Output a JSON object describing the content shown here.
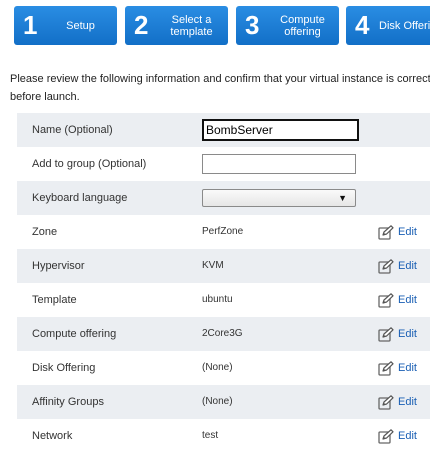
{
  "steps": [
    {
      "number": "1",
      "label": "Setup"
    },
    {
      "number": "2",
      "label": "Select a template"
    },
    {
      "number": "3",
      "label": "Compute offering"
    },
    {
      "number": "4",
      "label": "Disk Offeri"
    }
  ],
  "intro": "Please review the following information and confirm that your virtual instance is correct before launch.",
  "form": {
    "name": {
      "label": "Name (Optional)",
      "value": "BombServer"
    },
    "group": {
      "label": "Add to group (Optional)",
      "value": ""
    },
    "keyboard": {
      "label": "Keyboard language",
      "value": ""
    },
    "rows": [
      {
        "label": "Zone",
        "value": "PerfZone",
        "edit": "Edit"
      },
      {
        "label": "Hypervisor",
        "value": "KVM",
        "edit": "Edit"
      },
      {
        "label": "Template",
        "value": "ubuntu",
        "edit": "Edit"
      },
      {
        "label": "Compute offering",
        "value": "2Core3G",
        "edit": "Edit"
      },
      {
        "label": "Disk Offering",
        "value": "(None)",
        "edit": "Edit"
      },
      {
        "label": "Affinity Groups",
        "value": "(None)",
        "edit": "Edit"
      },
      {
        "label": "Network",
        "value": "test",
        "edit": "Edit"
      }
    ]
  },
  "icons": {
    "edit": "edit-pencil-icon",
    "dropdown": "chevron-down-icon"
  },
  "colors": {
    "step_bg": "#1c7ed6",
    "link": "#1a5fb4",
    "row_shade": "#ebeef2"
  }
}
